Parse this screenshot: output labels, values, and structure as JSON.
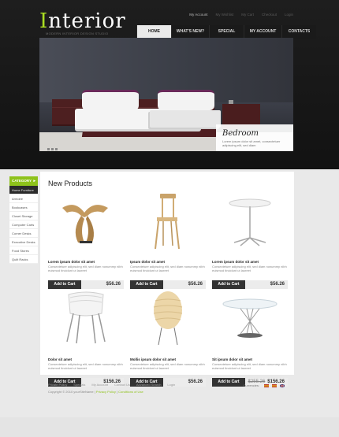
{
  "brand": {
    "logo_first": "I",
    "logo_rest": "nterior",
    "slogan": "MODERN INTERIOR DESIGN STUDIO",
    "accent": "#8ec21b"
  },
  "toplinks": [
    "My Account",
    "My Wishlist",
    "My Cart",
    "Checkout",
    "Login"
  ],
  "nav": [
    "HOME",
    "WHAT'S NEW?",
    "SPECIAL",
    "MY ACCOUNT",
    "CONTACTS"
  ],
  "hero": {
    "caption_title": "Bedroom",
    "caption_text": "Lorem ipsum dolor sit amet, consectetuer adipiscing elit, sed diam"
  },
  "sidebar": {
    "heading": "CATEGORY",
    "items": [
      "Home Furniture",
      "Armoire",
      "Bookcases",
      "Closet Storage",
      "Computer Carts",
      "Corner Desks",
      "Executive Desks",
      "Food Stores",
      "Quilt Racks"
    ]
  },
  "main": {
    "title": "New Products",
    "products": [
      {
        "name": "Lorem ipsum dolor sit amet",
        "desc": "Consectetuer adipiscing elit, sed diam nonummy nibh euismod tincidunt ut laoreet",
        "price": "$56.26",
        "old": "",
        "button": "Add to Cart",
        "icon": "butterfly-stool-icon"
      },
      {
        "name": "Ipsum dolor sit amet",
        "desc": "Consectetuer adipiscing elit, sed diam nonummy nibh euismod tincidunt ut laoreet",
        "price": "$56.26",
        "old": "",
        "button": "Add to Cart",
        "icon": "wooden-chair-icon"
      },
      {
        "name": "Lorem ipsum dolor sit amet",
        "desc": "Consectetuer adipiscing elit, sed diam nonummy nibh euismod tincidunt ut laoreet",
        "price": "$56.26",
        "old": "",
        "button": "Add to Cart",
        "icon": "round-table-icon"
      },
      {
        "name": "Dolor sit amet",
        "desc": "Consectetuer adipiscing elit, sed diam nonummy nibh euismod tincidunt ut laoreet",
        "price": "$156.26",
        "old": "",
        "button": "Add to Cart",
        "icon": "stacking-chairs-icon"
      },
      {
        "name": "Mollis ipsum dolor sit amet",
        "desc": "Consectetuer adipiscing elit, sed diam nonummy nibh euismod tincidunt ut laoreet",
        "price": "$56.26",
        "old": "",
        "button": "Add to Cart",
        "icon": "paper-lamp-icon"
      },
      {
        "name": "Sit ipsum dolor sit amet",
        "desc": "Consectetuer adipiscing elit, sed diam nonummy nibh euismod tincidunt ut laoreet",
        "price": "$156.26",
        "old": "$255.26",
        "button": "Add to Cart",
        "icon": "glass-table-icon"
      }
    ]
  },
  "footer": {
    "links": [
      "Private Policy",
      "Specials",
      "My Account",
      "Contact Us",
      "Advanced Search",
      "Login"
    ],
    "copyright": "Copyright © 2010 yourSiteName",
    "privacy": "Privacy Policy",
    "conditions": "Conditions of Use",
    "currencies_label": "Currencies:",
    "flags": [
      "#c0392b",
      "#e0b020",
      "#2c3e8c"
    ]
  }
}
